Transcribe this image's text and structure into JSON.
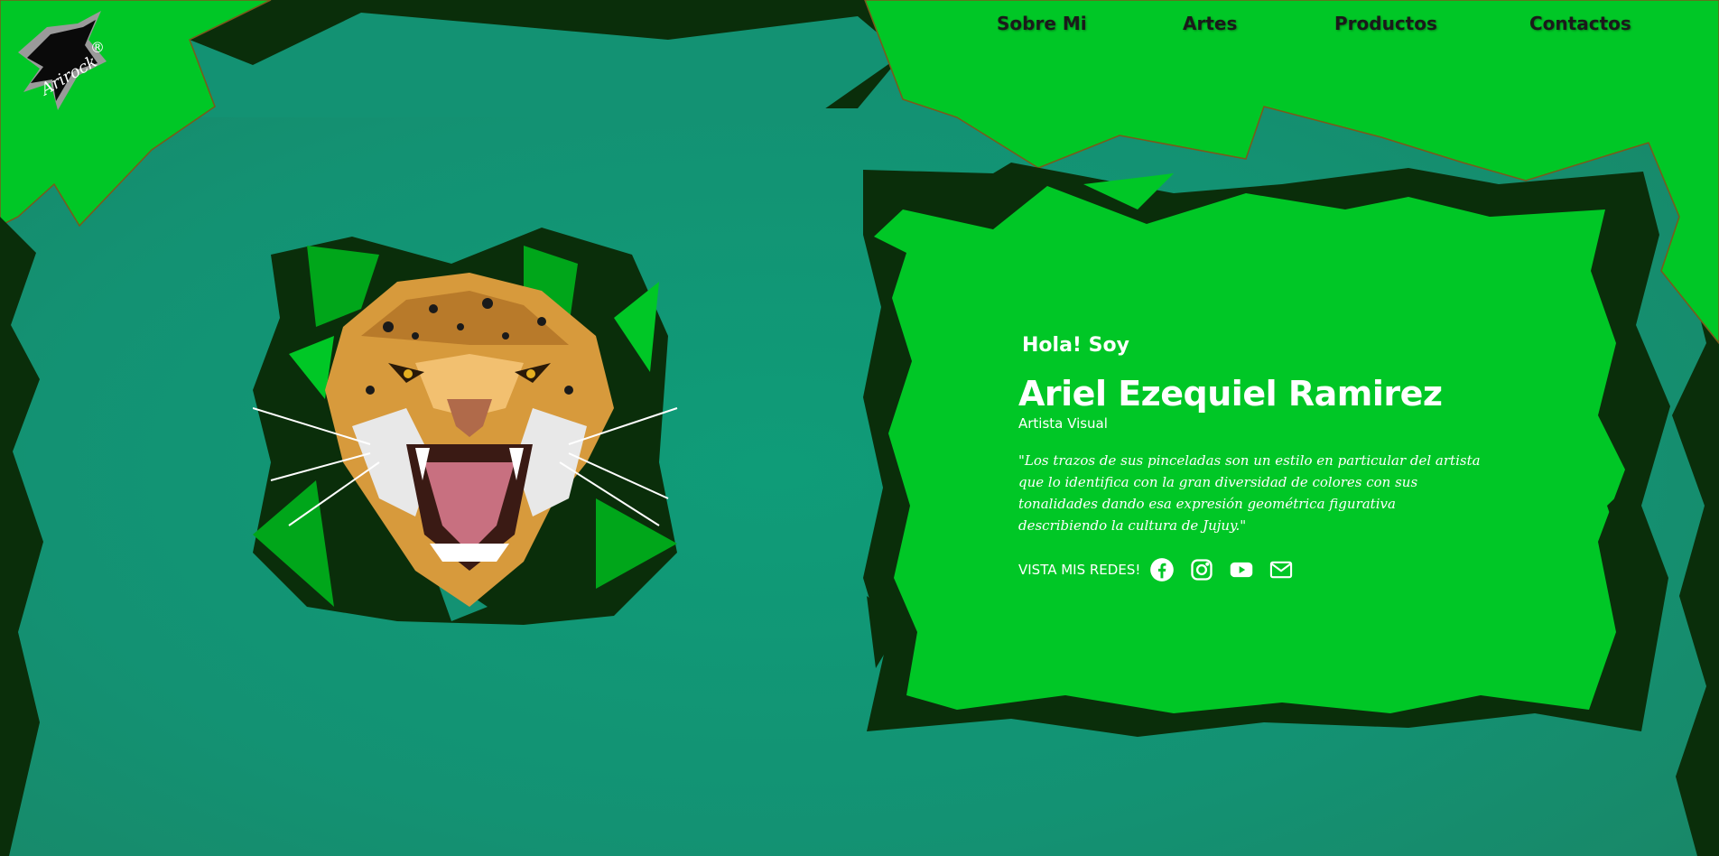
{
  "brand": {
    "logo_text": "Arirock",
    "logo_mark": "®"
  },
  "nav": {
    "items": [
      {
        "label": "Sobre Mi"
      },
      {
        "label": "Artes"
      },
      {
        "label": "Productos"
      },
      {
        "label": "Contactos"
      }
    ]
  },
  "hero": {
    "greeting": "Hola! Soy",
    "name": "Ariel Ezequiel Ramirez",
    "role": "Artista Visual",
    "quote": "\"Los trazos de sus pinceladas son un estilo en particular del artista que lo identifica con la gran diversidad de colores con sus tonalidades dando esa expresión geométrica figurativa describiendo la cultura de Jujuy.\"",
    "social_label": "VISTA MIS REDES!",
    "social_icons": [
      "facebook-icon",
      "instagram-icon",
      "youtube-icon",
      "mail-icon"
    ]
  },
  "colors": {
    "bright_green": "#00c726",
    "dark_green": "#0a2e0a",
    "teal": "#12997a",
    "nav_text": "#1a1a1a",
    "white": "#ffffff"
  }
}
